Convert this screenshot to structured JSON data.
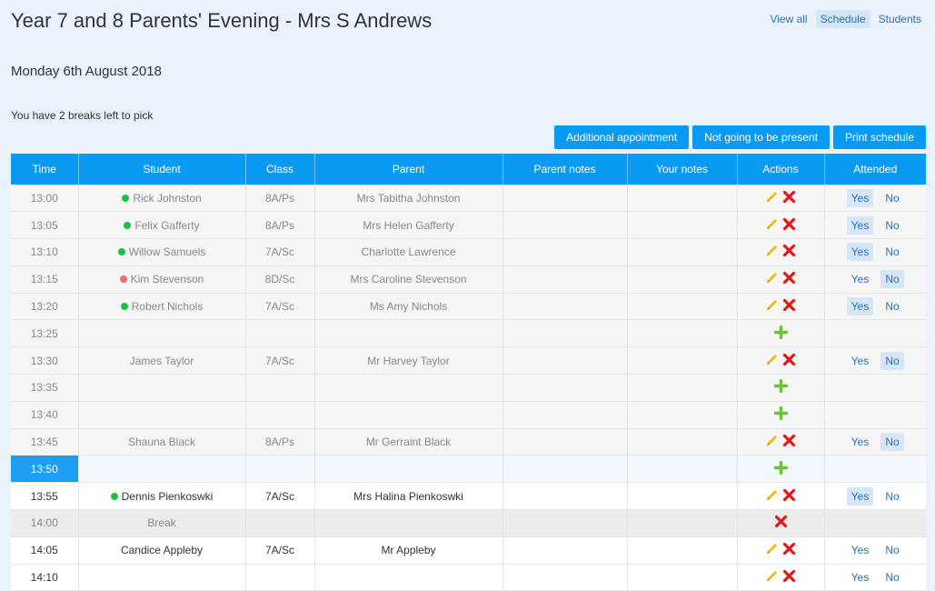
{
  "header": {
    "title": "Year 7 and 8 Parents' Evening - Mrs S Andrews",
    "nav": [
      {
        "label": "View all",
        "active": false
      },
      {
        "label": "Schedule",
        "active": true
      },
      {
        "label": "Students",
        "active": false
      }
    ]
  },
  "date": "Monday 6th August 2018",
  "breaks_text": "You have 2 breaks left to pick",
  "buttons": {
    "additional": "Additional appointment",
    "not_present": "Not going to be present",
    "print": "Print schedule"
  },
  "table": {
    "columns": [
      "Time",
      "Student",
      "Class",
      "Parent",
      "Parent notes",
      "Your notes",
      "Actions",
      "Attended"
    ],
    "attended_labels": {
      "yes": "Yes",
      "no": "No"
    },
    "rows": [
      {
        "time": "13:00",
        "student": "Rick Johnston",
        "status": "green",
        "class": "8A/Ps",
        "parent": "Mrs Tabitha Johnston",
        "actions": "edit-delete",
        "attended": "yes",
        "state": "past"
      },
      {
        "time": "13:05",
        "student": "Felix Gafferty",
        "status": "green",
        "class": "8A/Ps",
        "parent": "Mrs Helen Gafferty",
        "actions": "edit-delete",
        "attended": "yes",
        "state": "past"
      },
      {
        "time": "13:10",
        "student": "Willow Samuels",
        "status": "green",
        "class": "7A/Sc",
        "parent": "Charlotte Lawrence",
        "actions": "edit-delete",
        "attended": "yes",
        "state": "past"
      },
      {
        "time": "13:15",
        "student": "Kim Stevenson",
        "status": "red",
        "class": "8D/Sc",
        "parent": "Mrs Caroline Stevenson",
        "actions": "edit-delete",
        "attended": "no",
        "state": "past"
      },
      {
        "time": "13:20",
        "student": "Robert Nichols",
        "status": "green",
        "class": "7A/Sc",
        "parent": "Ms Amy Nichols",
        "actions": "edit-delete",
        "attended": "yes",
        "state": "past"
      },
      {
        "time": "13:25",
        "student": "",
        "status": "",
        "class": "",
        "parent": "",
        "actions": "add",
        "attended": "",
        "state": "past"
      },
      {
        "time": "13:30",
        "student": "James Taylor",
        "status": "",
        "class": "7A/Sc",
        "parent": "Mr Harvey Taylor",
        "actions": "edit-delete",
        "attended": "no",
        "state": "past"
      },
      {
        "time": "13:35",
        "student": "",
        "status": "",
        "class": "",
        "parent": "",
        "actions": "add",
        "attended": "",
        "state": "past"
      },
      {
        "time": "13:40",
        "student": "",
        "status": "",
        "class": "",
        "parent": "",
        "actions": "add",
        "attended": "",
        "state": "past"
      },
      {
        "time": "13:45",
        "student": "Shauna Black",
        "status": "",
        "class": "8A/Ps",
        "parent": "Mr Gerraint Black",
        "actions": "edit-delete",
        "attended": "no",
        "state": "past"
      },
      {
        "time": "13:50",
        "student": "",
        "status": "",
        "class": "",
        "parent": "",
        "actions": "add",
        "attended": "",
        "state": "current"
      },
      {
        "time": "13:55",
        "student": "Dennis Pienkoswki",
        "status": "green",
        "class": "7A/Sc",
        "parent": "Mrs Halina Pienkoswki",
        "actions": "edit-delete",
        "attended": "yes",
        "state": "future"
      },
      {
        "time": "14:00",
        "student": "Break",
        "status": "",
        "class": "",
        "parent": "",
        "actions": "delete",
        "attended": "",
        "state": "break"
      },
      {
        "time": "14:05",
        "student": "Candice Appleby",
        "status": "",
        "class": "7A/Sc",
        "parent": "Mr Appleby",
        "actions": "edit-delete",
        "attended": "none",
        "state": "future"
      },
      {
        "time": "14:10",
        "student": "",
        "status": "",
        "class": "",
        "parent": "",
        "actions": "edit-delete",
        "attended": "none",
        "state": "future"
      }
    ]
  },
  "colors": {
    "accent": "#0a9af2",
    "edit": "#f5b80c",
    "delete": "#e4171b",
    "add": "#6cc23a",
    "present": "#17c53a",
    "absent": "#f06a6a"
  }
}
